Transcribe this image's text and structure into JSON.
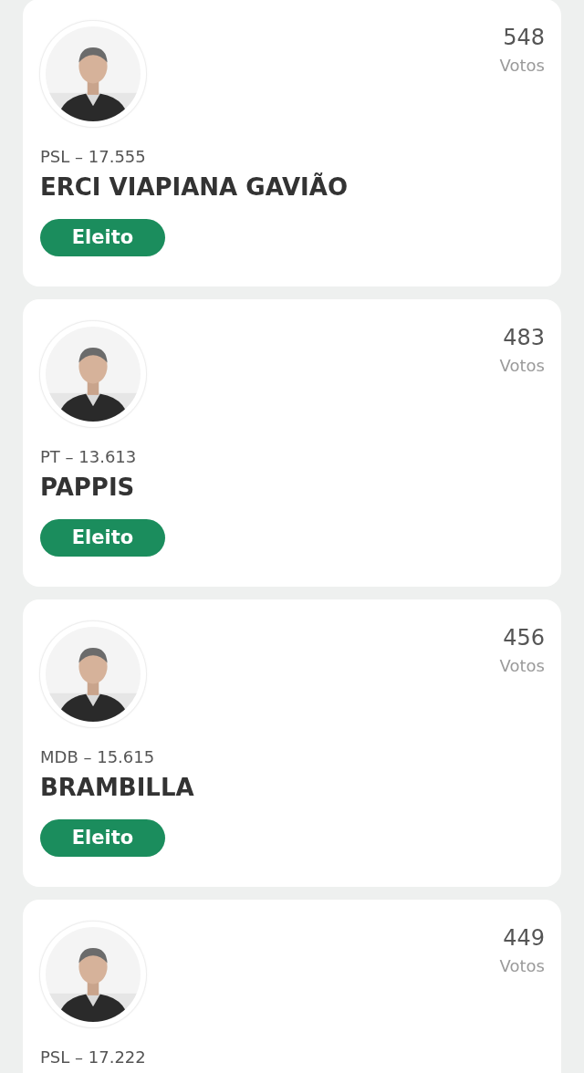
{
  "candidates": [
    {
      "votes": "548",
      "votes_label": "Votos",
      "party": "PSL – 17.555",
      "name": "ERCI VIAPIANA GAVIÃO",
      "status": {
        "label": "Eleito",
        "kind": "elected"
      }
    },
    {
      "votes": "483",
      "votes_label": "Votos",
      "party": "PT – 13.613",
      "name": "PAPPIS",
      "status": {
        "label": "Eleito",
        "kind": "elected"
      }
    },
    {
      "votes": "456",
      "votes_label": "Votos",
      "party": "MDB – 15.615",
      "name": "BRAMBILLA",
      "status": {
        "label": "Eleito",
        "kind": "elected"
      }
    },
    {
      "votes": "449",
      "votes_label": "Votos",
      "party": "PSL – 17.222"
    }
  ]
}
